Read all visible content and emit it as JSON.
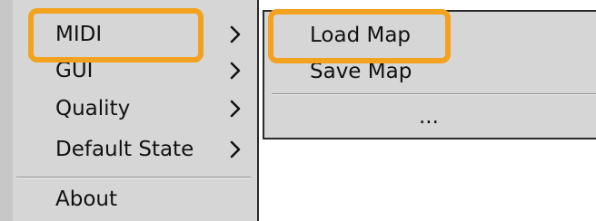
{
  "main_menu": {
    "items": [
      {
        "label": "MIDI",
        "has_submenu": true
      },
      {
        "label": "GUI",
        "has_submenu": true
      },
      {
        "label": "Quality",
        "has_submenu": true
      },
      {
        "label": "Default State",
        "has_submenu": true
      },
      {
        "label": "About",
        "has_submenu": false
      }
    ]
  },
  "submenu": {
    "items": [
      {
        "label": "Load Map"
      },
      {
        "label": "Save Map"
      },
      {
        "label": "..."
      }
    ]
  },
  "highlight_color": "#f3a21f",
  "icons": {
    "submenu_arrow": "chevron-right-icon"
  }
}
